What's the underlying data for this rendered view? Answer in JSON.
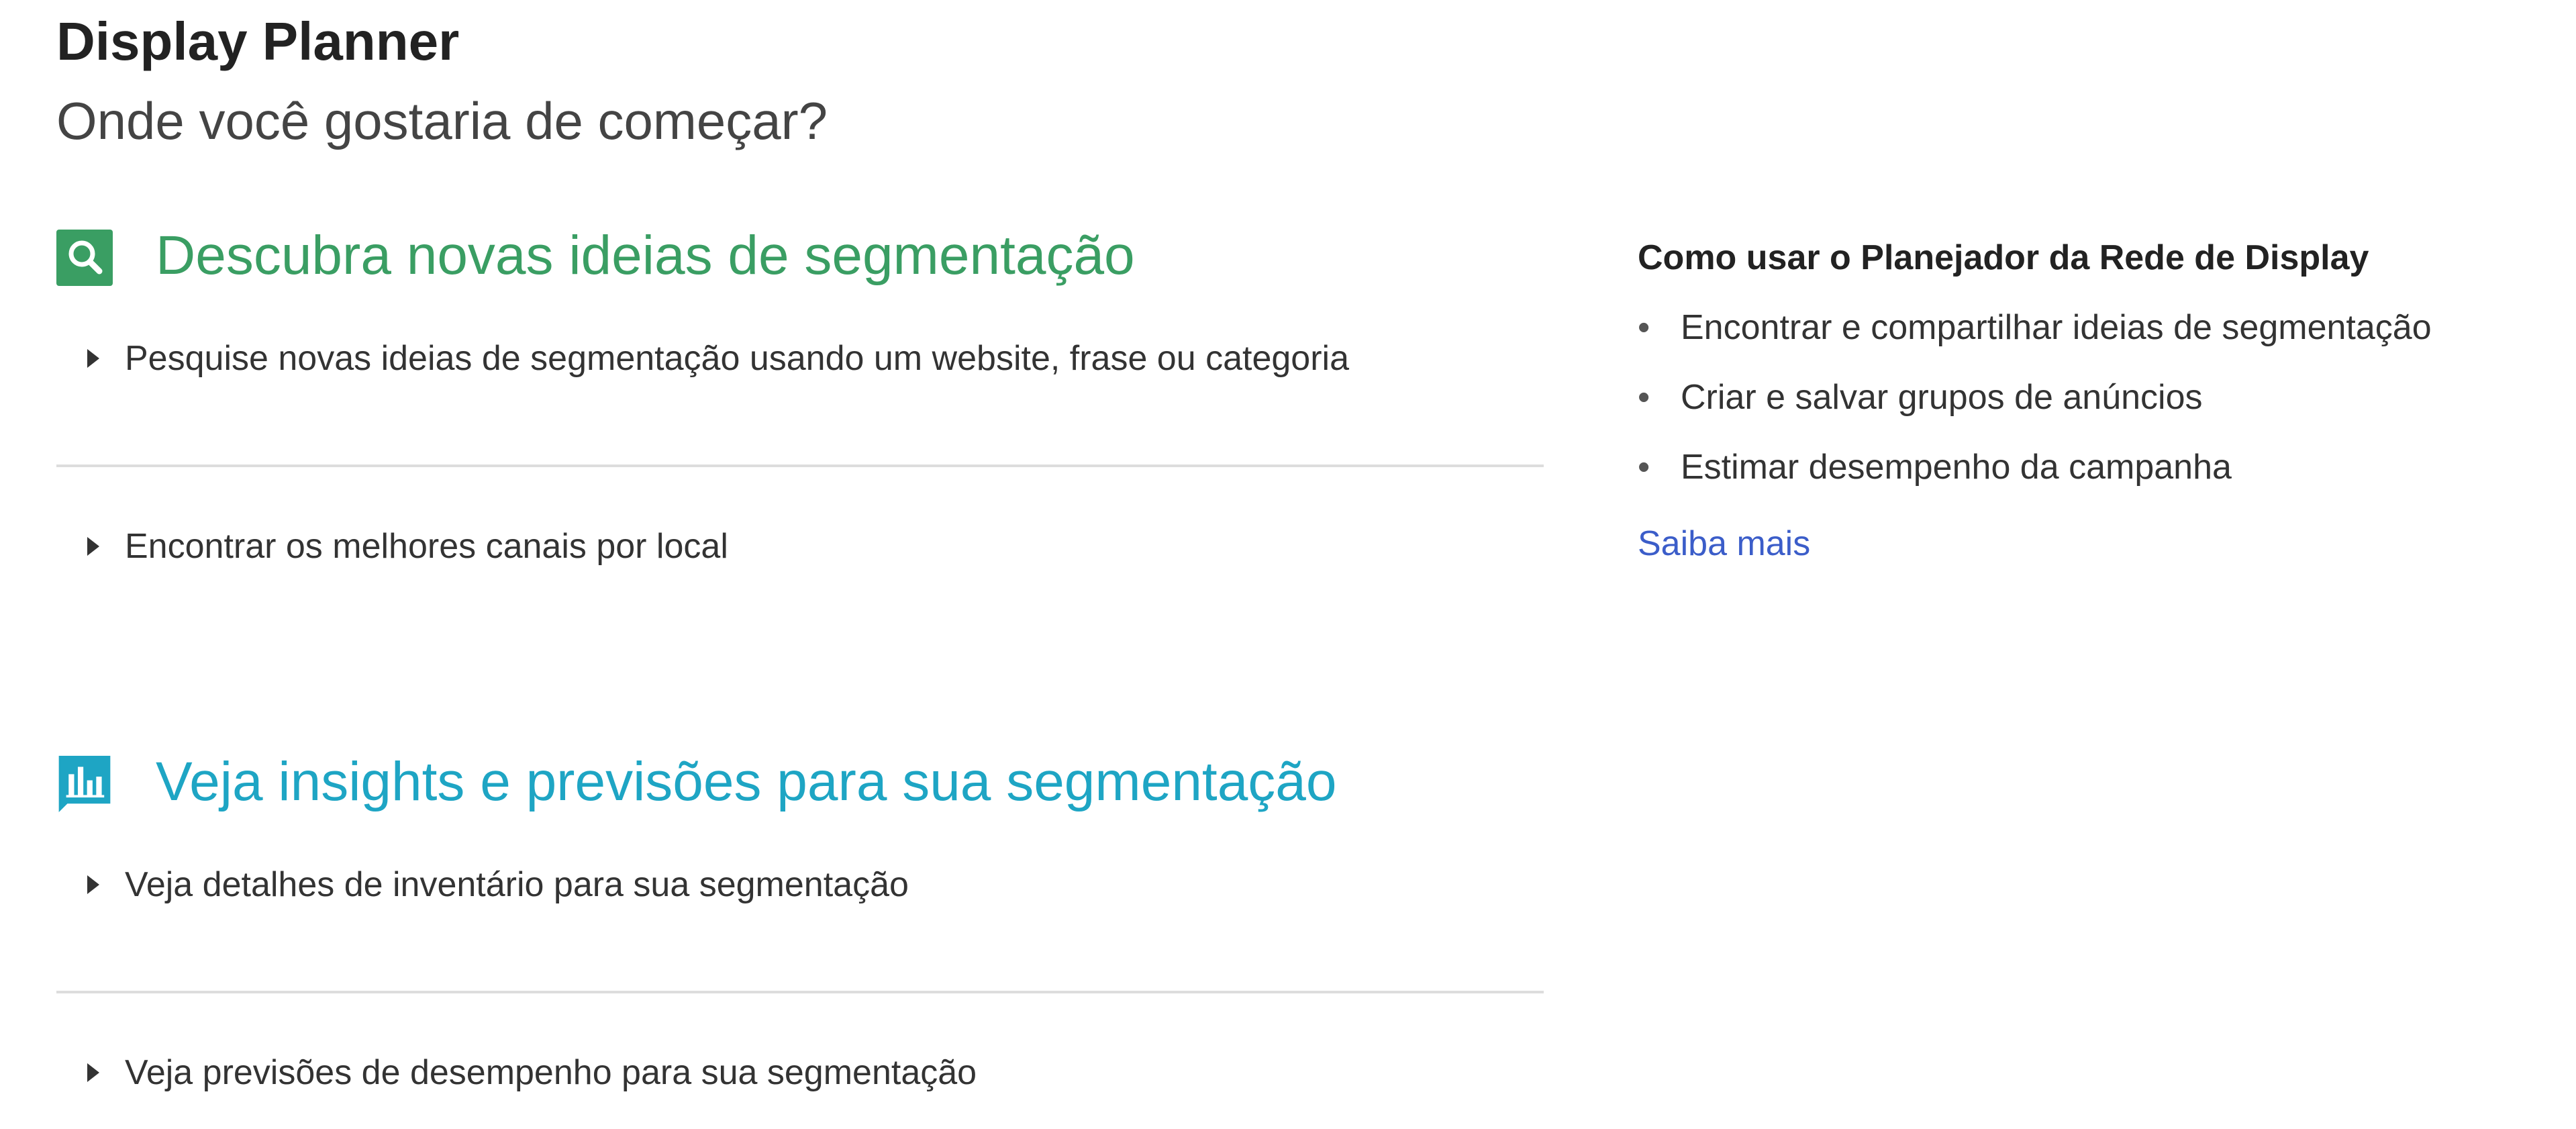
{
  "header": {
    "app_title": "Display Planner",
    "subtitle": "Onde você gostaria de começar?"
  },
  "sections": [
    {
      "title": "Descubra novas ideias de segmentação",
      "icon": "search-icon",
      "color": "#3a9e63",
      "options": [
        {
          "label": "Pesquise novas ideias de segmentação usando um website, frase ou categoria"
        },
        {
          "label": "Encontrar os melhores canais por local"
        }
      ]
    },
    {
      "title": "Veja insights e previsões para sua segmentação",
      "icon": "bar-chart-icon",
      "color": "#1ea5c4",
      "options": [
        {
          "label": "Veja detalhes de inventário para sua segmentação"
        },
        {
          "label": "Veja previsões de desempenho para sua segmentação"
        }
      ]
    }
  ],
  "sidebar": {
    "title": "Como usar o Planejador da Rede de Display",
    "items": [
      {
        "label": "Encontrar e compartilhar ideias de segmentação"
      },
      {
        "label": "Criar e salvar grupos de anúncios"
      },
      {
        "label": "Estimar desempenho da campanha"
      }
    ],
    "bullet": "•",
    "learn_more": "Saiba mais"
  },
  "colors": {
    "accent_green": "#3a9e63",
    "accent_teal": "#1ea5c4",
    "link_blue": "#3b5dc9",
    "divider": "#dddddd"
  }
}
